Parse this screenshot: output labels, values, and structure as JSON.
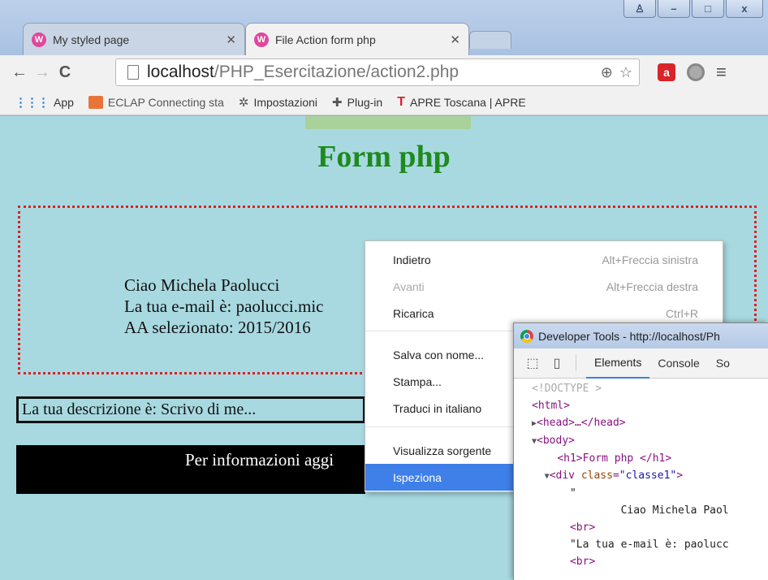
{
  "tabs": [
    {
      "title": "My styled page",
      "favicon": "W"
    },
    {
      "title": "File Action form php",
      "favicon": "W"
    }
  ],
  "window_controls": {
    "user": "♙",
    "minimize": "–",
    "maximize": "□",
    "close": "x"
  },
  "nav": {
    "back": "←",
    "forward": "→",
    "reload": "C"
  },
  "address": {
    "host": "localhost",
    "path": "/PHP_Esercitazione/action2.php"
  },
  "omnibox_icons": {
    "zoom": "⊕",
    "star": "☆"
  },
  "extensions": {
    "avira_label": "a"
  },
  "menu_icon": "≡",
  "bookmarks": [
    {
      "label": "App",
      "icon": "apps-icon"
    },
    {
      "label": "ECLAP Connecting sta",
      "icon": "eclap-icon"
    },
    {
      "label": "Impostazioni",
      "icon": "gear-icon"
    },
    {
      "label": "Plug-in",
      "icon": "puzzle-icon"
    },
    {
      "label": "APRE Toscana | APRE",
      "icon": "apre-icon"
    }
  ],
  "page": {
    "heading": "Form php",
    "greeting_lines": [
      "Ciao Michela Paolucci",
      "La tua e-mail è: paolucci.mic",
      "AA selezionato: 2015/2016"
    ],
    "description": "La tua descrizione è: Scrivo di me...",
    "footer": "Per informazioni aggi"
  },
  "context_menu": [
    {
      "label": "Indietro",
      "shortcut": "Alt+Freccia sinistra",
      "disabled": false
    },
    {
      "label": "Avanti",
      "shortcut": "Alt+Freccia destra",
      "disabled": true
    },
    {
      "label": "Ricarica",
      "shortcut": "Ctrl+R",
      "disabled": false
    },
    {
      "label": "Salva con nome...",
      "shortcut": "",
      "disabled": false
    },
    {
      "label": "Stampa...",
      "shortcut": "",
      "disabled": false
    },
    {
      "label": "Traduci in italiano",
      "shortcut": "",
      "disabled": false
    },
    {
      "label": "Visualizza sorgente",
      "shortcut": "",
      "disabled": false
    },
    {
      "label": "Ispeziona",
      "shortcut": "",
      "disabled": false,
      "highlighted": true
    }
  ],
  "devtools": {
    "title": "Developer Tools - http://localhost/Ph",
    "tabs": [
      "Elements",
      "Console",
      "So"
    ],
    "active_tab": "Elements",
    "code": {
      "doctype": "<!DOCTYPE >",
      "html_open": "<html>",
      "head": "<head>…</head>",
      "body_open": "<body>",
      "h1": "<h1>Form php </h1>",
      "div_tag": "div",
      "div_attr": "class",
      "div_val": "\"classe1\"",
      "text_quote": "\"",
      "text_ciao": "Ciao Michela Paol",
      "br1": "<br>",
      "text_email": "\"La tua e-mail è: paolucc",
      "br2": "<br>"
    }
  }
}
